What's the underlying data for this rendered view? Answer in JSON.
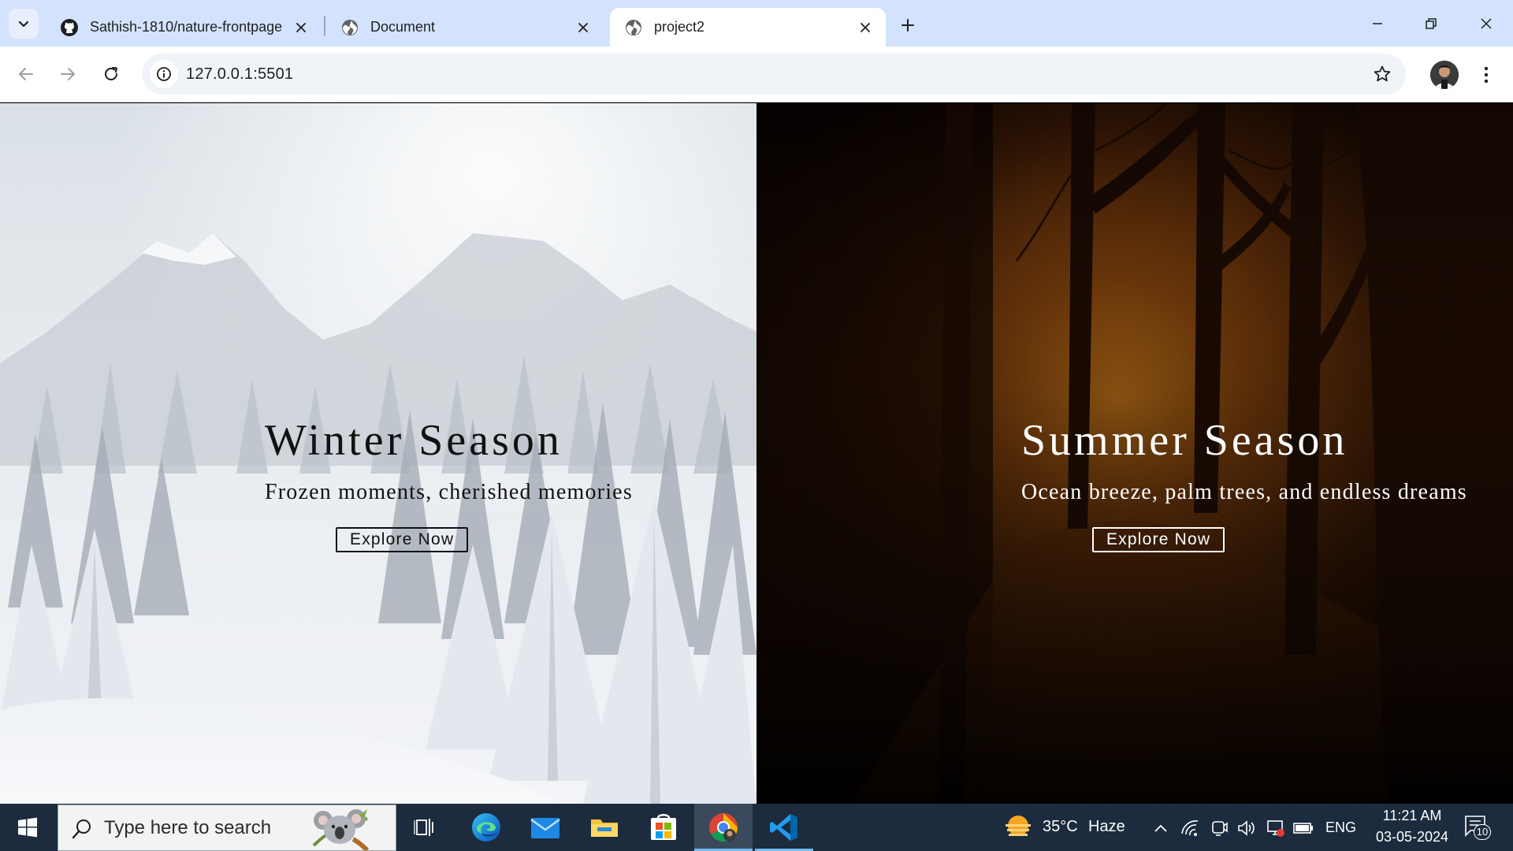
{
  "browser": {
    "tabs": [
      {
        "title": "Sathish-1810/nature-frontpage",
        "icon": "github-icon",
        "active": false
      },
      {
        "title": "Document",
        "icon": "globe-icon",
        "active": false
      },
      {
        "title": "project2",
        "icon": "globe-icon",
        "active": true
      }
    ],
    "url": "127.0.0.1:5501"
  },
  "page": {
    "winter": {
      "title": "Winter Season",
      "subtitle": "Frozen moments, cherished memories",
      "button": "Explore Now"
    },
    "summer": {
      "title": "Summer Season",
      "subtitle": "Ocean breeze, palm trees, and endless dreams",
      "button": "Explore Now"
    }
  },
  "taskbar": {
    "search_placeholder": "Type here to search",
    "weather": {
      "temp": "35°C",
      "condition": "Haze"
    },
    "language": "ENG",
    "time": "11:21 AM",
    "date": "03-05-2024",
    "notification_count": "10"
  },
  "colors": {
    "tabstrip": "#d3e3fd",
    "taskbar": "#1c2b3d",
    "summer_glow": "#c07618"
  }
}
